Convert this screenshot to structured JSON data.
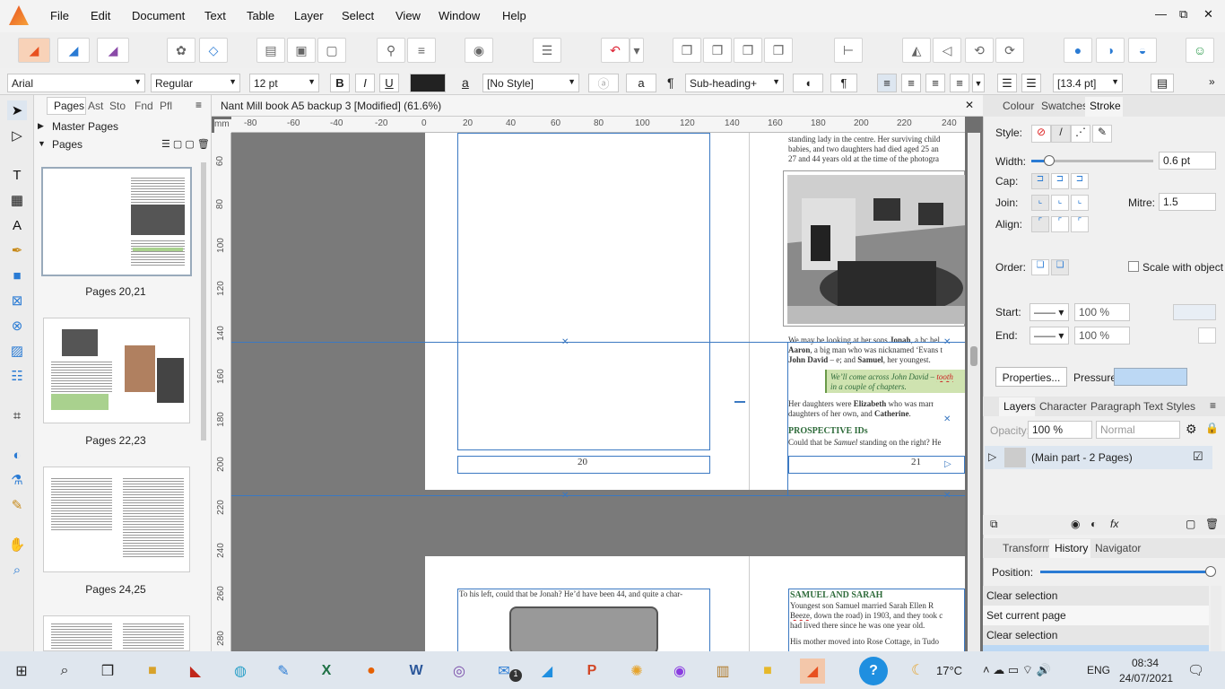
{
  "menu": {
    "items": [
      "File",
      "Edit",
      "Document",
      "Text",
      "Table",
      "Layer",
      "Select",
      "View",
      "Window",
      "Help"
    ]
  },
  "window_controls": {
    "minimize": "—",
    "restore": "⧉",
    "close": "✕"
  },
  "context": {
    "font": "Arial",
    "weight": "Regular",
    "size": "12 pt",
    "bold": "B",
    "italic": "I",
    "underline": "U",
    "char_style": "[No Style]",
    "para_style": "Sub-heading+",
    "leading": "[13.4 pt]",
    "pilcrow": "¶",
    "a_label": "a"
  },
  "pages_panel": {
    "tabs": [
      "Pages",
      "Ast",
      "Sto",
      "Fnd",
      "Pfl"
    ],
    "master": "Master Pages",
    "pages": "Pages",
    "thumbs": [
      "Pages 20,21",
      "Pages 22,23",
      "Pages 24,25"
    ]
  },
  "document": {
    "title": "Nant Mill book A5 backup 3 [Modified] (61.6%)",
    "unit": "mm",
    "ruler_h": [
      "-80",
      "-60",
      "-40",
      "-20",
      "0",
      "20",
      "40",
      "60",
      "80",
      "100",
      "120",
      "140",
      "160",
      "180",
      "200",
      "220",
      "240"
    ],
    "ruler_v": [
      "60",
      "80",
      "100",
      "120",
      "140",
      "160",
      "180",
      "200",
      "220",
      "240",
      "260",
      "280"
    ]
  },
  "page_content": {
    "l1": "standing lady in the centre. Her surviving child",
    "l2": "babies, and two daughters had died aged 25 an",
    "l3": "27 and 44 years old at the time of the photogra",
    "p1a": "We may be looking at her sons ",
    "p1b": "Jonah",
    "p1c": ", a bc hel",
    "p2a": "Aaron",
    "p2b": ", a big man who was nicknamed ‘Evans t",
    "p3a": "John David",
    "p3b": " – e; and ",
    "p3c": "Samuel",
    "p3d": ", her youngest.",
    "note1": "We’ll come across John David – ",
    "note1b": "tooth",
    "note2": "in a couple of chapters.",
    "d1a": "Her daughters were ",
    "d1b": "Elizabeth",
    "d1c": " who was marr",
    "d2a": "daughters of her own, and ",
    "d2b": "Catherine",
    "d2c": ".",
    "heading1": "PROSPECTIVE IDs",
    "q1a": "Could that be ",
    "q1b": "Samuel",
    "q1c": " standing on the right? He",
    "pagenum_left": "20",
    "pagenum_right": "21",
    "lower_left": "To his left, could that be Jonah? He’d have been 44, and quite a char-",
    "heading2": "SAMUEL AND SARAH",
    "s1": "Youngest son Samuel married Sarah Ellen R",
    "s2a": "Beeze",
    "s2b": ", down the road) in 1903, and they took c",
    "s3": "had lived there since he was one year old.",
    "s4": "His mother moved into Rose Cottage, in Tudo"
  },
  "right_panel": {
    "tabs_top": [
      "Colour",
      "Swatches",
      "Stroke"
    ],
    "style_label": "Style:",
    "width_label": "Width:",
    "width_value": "0.6 pt",
    "cap_label": "Cap:",
    "join_label": "Join:",
    "mitre_label": "Mitre:",
    "mitre_value": "1.5",
    "align_label": "Align:",
    "order_label": "Order:",
    "scale_label": "Scale with object",
    "start_label": "Start:",
    "end_label": "End:",
    "start_pct": "100 %",
    "end_pct": "100 %",
    "properties_btn": "Properties...",
    "pressure_label": "Pressure:",
    "tabs_layers": [
      "Layers",
      "Character",
      "Paragraph",
      "Text Styles"
    ],
    "opacity_label": "Opacity:",
    "opacity_value": "100 %",
    "blend": "Normal",
    "layer_name": "(Main part - 2 Pages)",
    "tabs_bottom": [
      "Transform",
      "History",
      "Navigator"
    ],
    "position_label": "Position:",
    "history": [
      "Clear selection",
      "Set current page",
      "Clear selection"
    ]
  },
  "taskbar": {
    "temp": "17°C",
    "lang": "ENG",
    "time": "08:34",
    "date": "24/07/2021",
    "notif": "1"
  },
  "colors": {
    "accent": "#2a7bd4",
    "heading_green": "#2e6b3a",
    "note_green": "#cfe3b0",
    "guide_blue": "#3b79c2"
  }
}
